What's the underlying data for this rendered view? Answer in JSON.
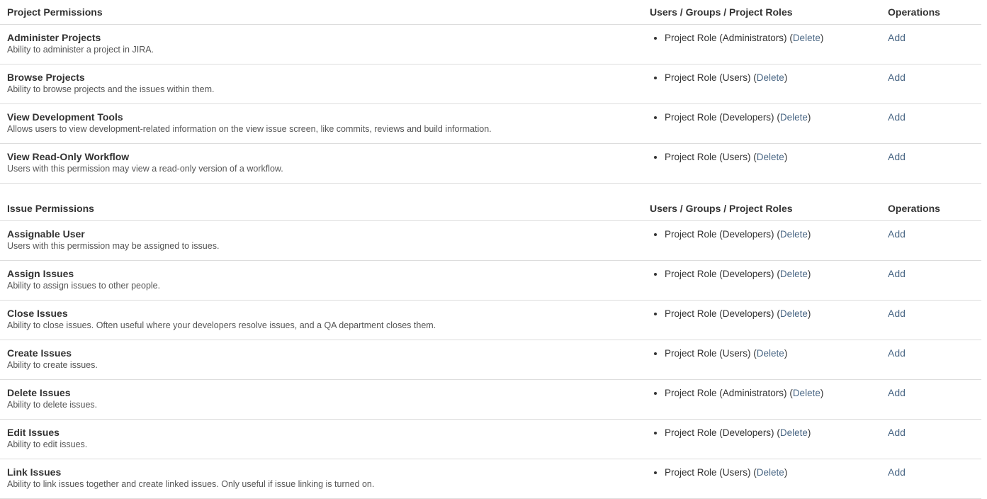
{
  "columns": {
    "name": "",
    "users": "Users / Groups / Project Roles",
    "operations": "Operations"
  },
  "links": {
    "add": "Add",
    "delete": "Delete",
    "open_paren": "(",
    "close_paren": ")"
  },
  "colors": {
    "link": "#4a6785",
    "text": "#333333",
    "muted": "#555555",
    "border": "#dddddd"
  },
  "sections": [
    {
      "title": "Project Permissions",
      "users_header": "Users / Groups / Project Roles",
      "operations_header": "Operations",
      "rows": [
        {
          "name": "Administer Projects",
          "description": "Ability to administer a project in JIRA.",
          "roles": [
            {
              "label": "Project Role (Administrators)",
              "delete": "Delete"
            }
          ],
          "operation": "Add"
        },
        {
          "name": "Browse Projects",
          "description": "Ability to browse projects and the issues within them.",
          "roles": [
            {
              "label": "Project Role (Users)",
              "delete": "Delete"
            }
          ],
          "operation": "Add"
        },
        {
          "name": "View Development Tools",
          "description": "Allows users to view development-related information on the view issue screen, like commits, reviews and build information.",
          "roles": [
            {
              "label": "Project Role (Developers)",
              "delete": "Delete"
            }
          ],
          "operation": "Add"
        },
        {
          "name": "View Read-Only Workflow",
          "description": "Users with this permission may view a read-only version of a workflow.",
          "roles": [
            {
              "label": "Project Role (Users)",
              "delete": "Delete"
            }
          ],
          "operation": "Add"
        }
      ]
    },
    {
      "title": "Issue Permissions",
      "users_header": "Users / Groups / Project Roles",
      "operations_header": "Operations",
      "rows": [
        {
          "name": "Assignable User",
          "description": "Users with this permission may be assigned to issues.",
          "roles": [
            {
              "label": "Project Role (Developers)",
              "delete": "Delete"
            }
          ],
          "operation": "Add"
        },
        {
          "name": "Assign Issues",
          "description": "Ability to assign issues to other people.",
          "roles": [
            {
              "label": "Project Role (Developers)",
              "delete": "Delete"
            }
          ],
          "operation": "Add"
        },
        {
          "name": "Close Issues",
          "description": "Ability to close issues. Often useful where your developers resolve issues, and a QA department closes them.",
          "roles": [
            {
              "label": "Project Role (Developers)",
              "delete": "Delete"
            }
          ],
          "operation": "Add"
        },
        {
          "name": "Create Issues",
          "description": "Ability to create issues.",
          "roles": [
            {
              "label": "Project Role (Users)",
              "delete": "Delete"
            }
          ],
          "operation": "Add"
        },
        {
          "name": "Delete Issues",
          "description": "Ability to delete issues.",
          "roles": [
            {
              "label": "Project Role (Administrators)",
              "delete": "Delete"
            }
          ],
          "operation": "Add"
        },
        {
          "name": "Edit Issues",
          "description": "Ability to edit issues.",
          "roles": [
            {
              "label": "Project Role (Developers)",
              "delete": "Delete"
            }
          ],
          "operation": "Add"
        },
        {
          "name": "Link Issues",
          "description": "Ability to link issues together and create linked issues. Only useful if issue linking is turned on.",
          "roles": [
            {
              "label": "Project Role (Users)",
              "delete": "Delete"
            }
          ],
          "operation": "Add"
        }
      ]
    }
  ]
}
